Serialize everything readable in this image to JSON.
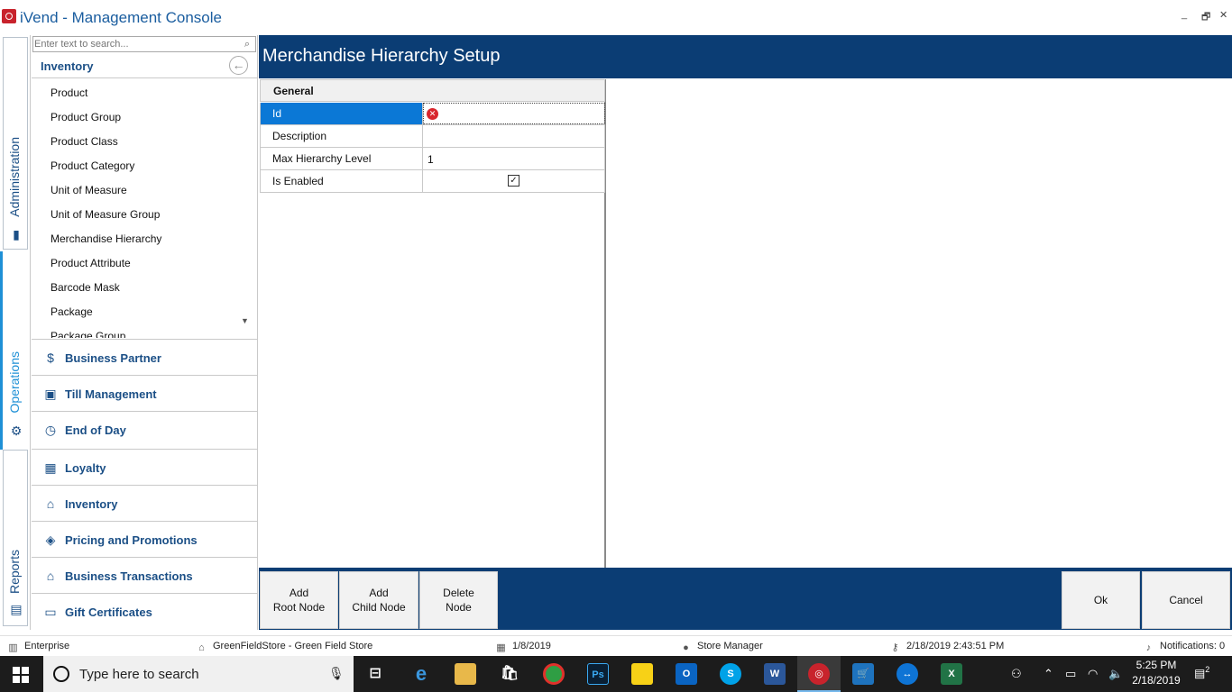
{
  "app": {
    "title": "iVend - Management Console"
  },
  "window": {
    "minimize_glyph": "_",
    "restore_glyph": "🗗",
    "close_glyph": "✕"
  },
  "rail": {
    "tabs": [
      {
        "label": "Administration",
        "icon": "briefcase-icon"
      },
      {
        "label": "Operations",
        "icon": "gear-icon"
      },
      {
        "label": "Reports",
        "icon": "report-icon"
      }
    ]
  },
  "navigator": {
    "search_placeholder": "Enter text to search...",
    "header": "Inventory",
    "items": [
      "Product",
      "Product Group",
      "Product Class",
      "Product Category",
      "Unit of Measure",
      "Unit of Measure Group",
      "Merchandise Hierarchy",
      "Product Attribute",
      "Barcode Mask",
      "Package",
      "Package Group"
    ],
    "sections": [
      {
        "label": "Business Partner",
        "icon": "business-partner-icon"
      },
      {
        "label": "Till Management",
        "icon": "till-icon"
      },
      {
        "label": "End of Day",
        "icon": "clock-icon"
      },
      {
        "label": "Loyalty",
        "icon": "gift-icon"
      },
      {
        "label": "Inventory",
        "icon": "warehouse-icon"
      },
      {
        "label": "Pricing and Promotions",
        "icon": "tag-icon"
      },
      {
        "label": "Business Transactions",
        "icon": "transactions-icon"
      },
      {
        "label": "Gift Certificates",
        "icon": "gift-certificate-icon"
      }
    ]
  },
  "main": {
    "title": "Merchandise Hierarchy Setup",
    "grid": {
      "category": "General",
      "rows": [
        {
          "name": "Id",
          "value": ""
        },
        {
          "name": "Description",
          "value": ""
        },
        {
          "name": "Max Hierarchy Level",
          "value": "1"
        },
        {
          "name": "Is Enabled",
          "value": "",
          "checked": true
        }
      ]
    },
    "actions": {
      "add_root_line1": "Add",
      "add_root_line2": "Root Node",
      "add_child_line1": "Add",
      "add_child_line2": "Child Node",
      "delete_line1": "Delete",
      "delete_line2": "Node",
      "ok": "Ok",
      "cancel": "Cancel"
    }
  },
  "status": {
    "edition": "Enterprise",
    "store": "GreenFieldStore - Green Field Store",
    "business_date": "1/8/2019",
    "role": "Store Manager",
    "login_time": "2/18/2019 2:43:51 PM",
    "notifications": "Notifications: 0"
  },
  "taskbar": {
    "search_placeholder": "Type here to search",
    "time": "5:25 PM",
    "date": "2/18/2019",
    "notification_count": "2"
  },
  "colors": {
    "brand_navy": "#0b3d74",
    "selection_blue": "#0b78d6",
    "link_blue": "#1b4f86",
    "error_red": "#d9262d"
  }
}
